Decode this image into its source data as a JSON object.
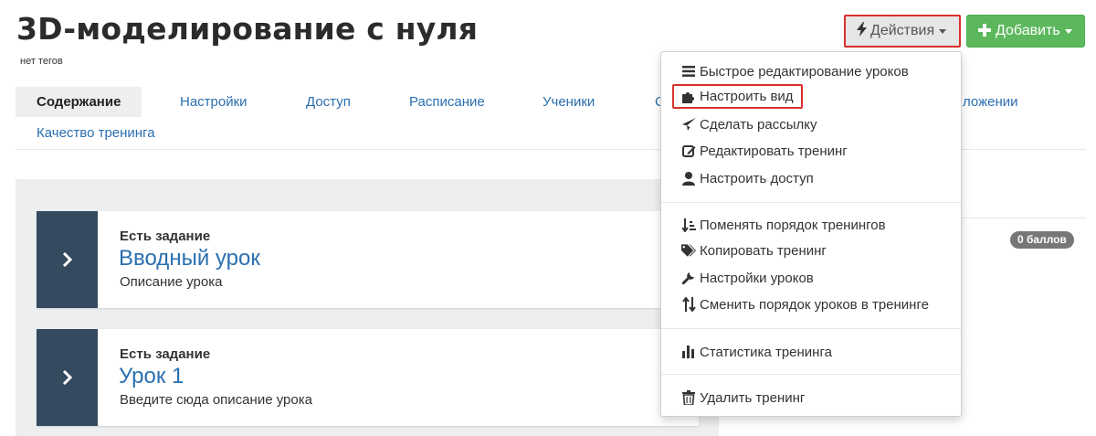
{
  "header": {
    "title": "3D-моделирование с нуля",
    "tags_text": "нет тегов"
  },
  "toolbar": {
    "actions_label": "Действия",
    "add_label": "Добавить",
    "colors": {
      "actions_bg": "#e6e6e6",
      "add_bg": "#5cb85c",
      "highlight": "#d9312b"
    }
  },
  "tabs": [
    {
      "label": "Содержание",
      "active": true
    },
    {
      "label": "Настройки"
    },
    {
      "label": "Доступ"
    },
    {
      "label": "Расписание"
    },
    {
      "label": "Ученики"
    },
    {
      "label": "С"
    },
    {
      "label": "ложении"
    },
    {
      "label": "Качество тренинга"
    }
  ],
  "lessons": [
    {
      "task_label": "Есть задание",
      "title": "Вводный урок",
      "description": "Описание урока"
    },
    {
      "task_label": "Есть задание",
      "title": "Урок 1",
      "description": "Введите сюда описание урока"
    }
  ],
  "points_badge": "0 баллов",
  "dropdown": {
    "items": [
      {
        "label": "Быстрое редактирование уроков",
        "icon": "list-icon"
      },
      {
        "label": "Настроить вид",
        "icon": "puzzle-icon",
        "highlighted": true
      },
      {
        "label": "Сделать рассылку",
        "icon": "send-icon"
      },
      {
        "label": "Редактировать тренинг",
        "icon": "edit-icon"
      },
      {
        "label": "Настроить доступ",
        "icon": "user-icon"
      },
      {
        "label": "Поменять порядок тренингов",
        "icon": "sort-icon"
      },
      {
        "label": "Копировать тренинг",
        "icon": "tags-icon"
      },
      {
        "label": "Настройки уроков",
        "icon": "wrench-icon"
      },
      {
        "label": "Сменить порядок уроков в тренинге",
        "icon": "swap-vertical-icon"
      },
      {
        "label": "Статистика тренинга",
        "icon": "bar-chart-icon"
      },
      {
        "label": "Удалить тренинг",
        "icon": "trash-icon"
      }
    ]
  }
}
